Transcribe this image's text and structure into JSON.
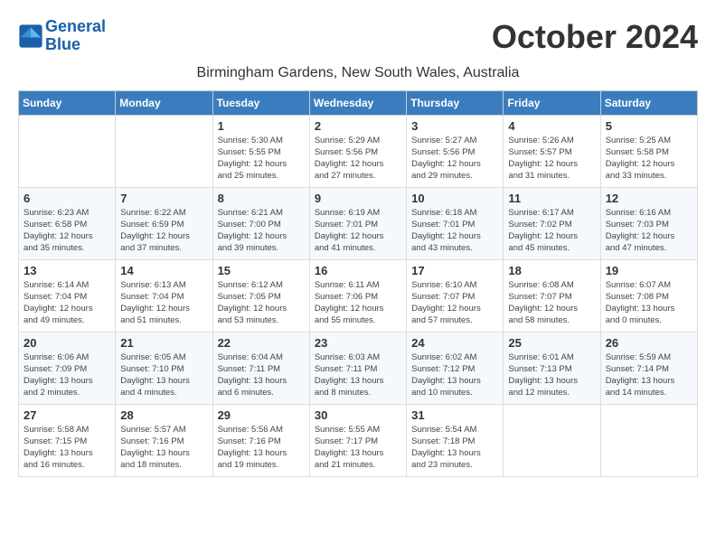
{
  "logo": {
    "line1": "General",
    "line2": "Blue"
  },
  "header": {
    "month_title": "October 2024",
    "subtitle": "Birmingham Gardens, New South Wales, Australia"
  },
  "weekdays": [
    "Sunday",
    "Monday",
    "Tuesday",
    "Wednesday",
    "Thursday",
    "Friday",
    "Saturday"
  ],
  "weeks": [
    [
      {
        "day": "",
        "info": ""
      },
      {
        "day": "",
        "info": ""
      },
      {
        "day": "1",
        "info": "Sunrise: 5:30 AM\nSunset: 5:55 PM\nDaylight: 12 hours\nand 25 minutes."
      },
      {
        "day": "2",
        "info": "Sunrise: 5:29 AM\nSunset: 5:56 PM\nDaylight: 12 hours\nand 27 minutes."
      },
      {
        "day": "3",
        "info": "Sunrise: 5:27 AM\nSunset: 5:56 PM\nDaylight: 12 hours\nand 29 minutes."
      },
      {
        "day": "4",
        "info": "Sunrise: 5:26 AM\nSunset: 5:57 PM\nDaylight: 12 hours\nand 31 minutes."
      },
      {
        "day": "5",
        "info": "Sunrise: 5:25 AM\nSunset: 5:58 PM\nDaylight: 12 hours\nand 33 minutes."
      }
    ],
    [
      {
        "day": "6",
        "info": "Sunrise: 6:23 AM\nSunset: 6:58 PM\nDaylight: 12 hours\nand 35 minutes."
      },
      {
        "day": "7",
        "info": "Sunrise: 6:22 AM\nSunset: 6:59 PM\nDaylight: 12 hours\nand 37 minutes."
      },
      {
        "day": "8",
        "info": "Sunrise: 6:21 AM\nSunset: 7:00 PM\nDaylight: 12 hours\nand 39 minutes."
      },
      {
        "day": "9",
        "info": "Sunrise: 6:19 AM\nSunset: 7:01 PM\nDaylight: 12 hours\nand 41 minutes."
      },
      {
        "day": "10",
        "info": "Sunrise: 6:18 AM\nSunset: 7:01 PM\nDaylight: 12 hours\nand 43 minutes."
      },
      {
        "day": "11",
        "info": "Sunrise: 6:17 AM\nSunset: 7:02 PM\nDaylight: 12 hours\nand 45 minutes."
      },
      {
        "day": "12",
        "info": "Sunrise: 6:16 AM\nSunset: 7:03 PM\nDaylight: 12 hours\nand 47 minutes."
      }
    ],
    [
      {
        "day": "13",
        "info": "Sunrise: 6:14 AM\nSunset: 7:04 PM\nDaylight: 12 hours\nand 49 minutes."
      },
      {
        "day": "14",
        "info": "Sunrise: 6:13 AM\nSunset: 7:04 PM\nDaylight: 12 hours\nand 51 minutes."
      },
      {
        "day": "15",
        "info": "Sunrise: 6:12 AM\nSunset: 7:05 PM\nDaylight: 12 hours\nand 53 minutes."
      },
      {
        "day": "16",
        "info": "Sunrise: 6:11 AM\nSunset: 7:06 PM\nDaylight: 12 hours\nand 55 minutes."
      },
      {
        "day": "17",
        "info": "Sunrise: 6:10 AM\nSunset: 7:07 PM\nDaylight: 12 hours\nand 57 minutes."
      },
      {
        "day": "18",
        "info": "Sunrise: 6:08 AM\nSunset: 7:07 PM\nDaylight: 12 hours\nand 58 minutes."
      },
      {
        "day": "19",
        "info": "Sunrise: 6:07 AM\nSunset: 7:08 PM\nDaylight: 13 hours\nand 0 minutes."
      }
    ],
    [
      {
        "day": "20",
        "info": "Sunrise: 6:06 AM\nSunset: 7:09 PM\nDaylight: 13 hours\nand 2 minutes."
      },
      {
        "day": "21",
        "info": "Sunrise: 6:05 AM\nSunset: 7:10 PM\nDaylight: 13 hours\nand 4 minutes."
      },
      {
        "day": "22",
        "info": "Sunrise: 6:04 AM\nSunset: 7:11 PM\nDaylight: 13 hours\nand 6 minutes."
      },
      {
        "day": "23",
        "info": "Sunrise: 6:03 AM\nSunset: 7:11 PM\nDaylight: 13 hours\nand 8 minutes."
      },
      {
        "day": "24",
        "info": "Sunrise: 6:02 AM\nSunset: 7:12 PM\nDaylight: 13 hours\nand 10 minutes."
      },
      {
        "day": "25",
        "info": "Sunrise: 6:01 AM\nSunset: 7:13 PM\nDaylight: 13 hours\nand 12 minutes."
      },
      {
        "day": "26",
        "info": "Sunrise: 5:59 AM\nSunset: 7:14 PM\nDaylight: 13 hours\nand 14 minutes."
      }
    ],
    [
      {
        "day": "27",
        "info": "Sunrise: 5:58 AM\nSunset: 7:15 PM\nDaylight: 13 hours\nand 16 minutes."
      },
      {
        "day": "28",
        "info": "Sunrise: 5:57 AM\nSunset: 7:16 PM\nDaylight: 13 hours\nand 18 minutes."
      },
      {
        "day": "29",
        "info": "Sunrise: 5:56 AM\nSunset: 7:16 PM\nDaylight: 13 hours\nand 19 minutes."
      },
      {
        "day": "30",
        "info": "Sunrise: 5:55 AM\nSunset: 7:17 PM\nDaylight: 13 hours\nand 21 minutes."
      },
      {
        "day": "31",
        "info": "Sunrise: 5:54 AM\nSunset: 7:18 PM\nDaylight: 13 hours\nand 23 minutes."
      },
      {
        "day": "",
        "info": ""
      },
      {
        "day": "",
        "info": ""
      }
    ]
  ]
}
